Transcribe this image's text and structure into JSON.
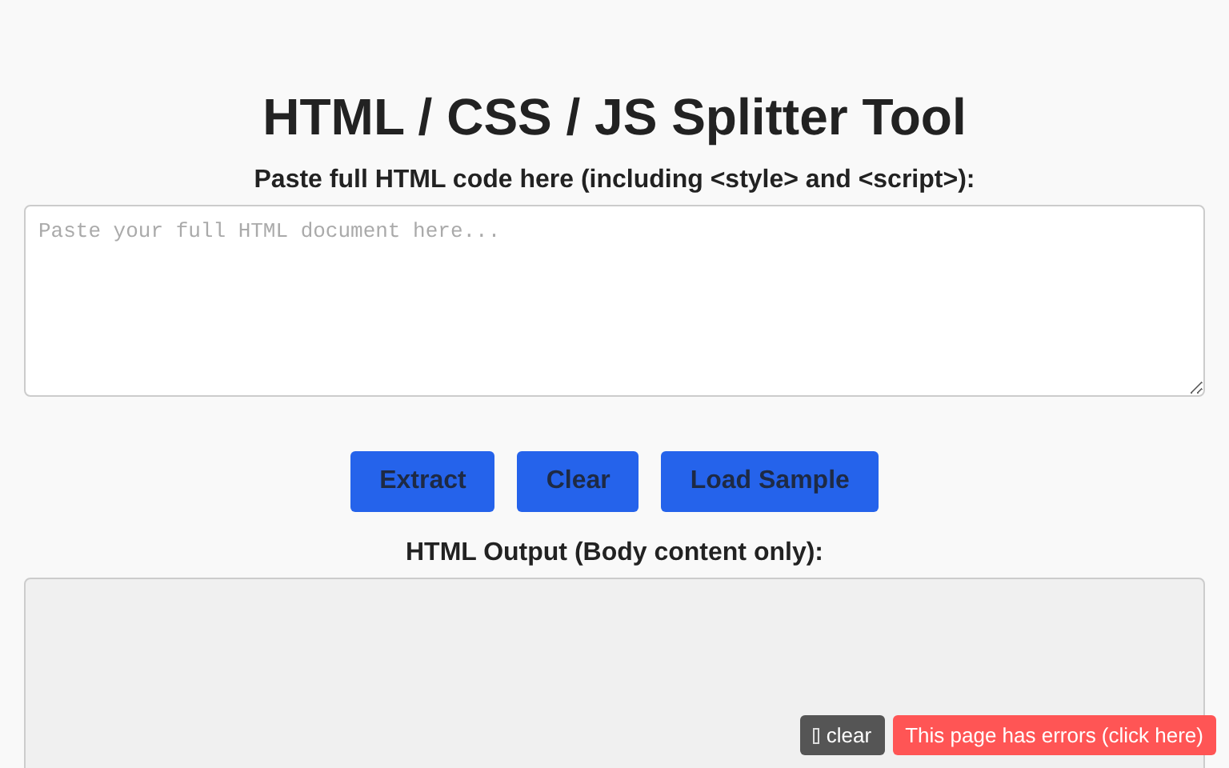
{
  "title": "HTML / CSS / JS Splitter Tool",
  "input": {
    "label": "Paste full HTML code here (including <style> and <script>):",
    "placeholder": "Paste your full HTML document here..."
  },
  "buttons": [
    "Extract",
    "Clear",
    "Load Sample"
  ],
  "output": {
    "label": "HTML Output (Body content only):"
  },
  "console": {
    "clear_label": "clear",
    "error_label": "This page has errors (click here)"
  }
}
